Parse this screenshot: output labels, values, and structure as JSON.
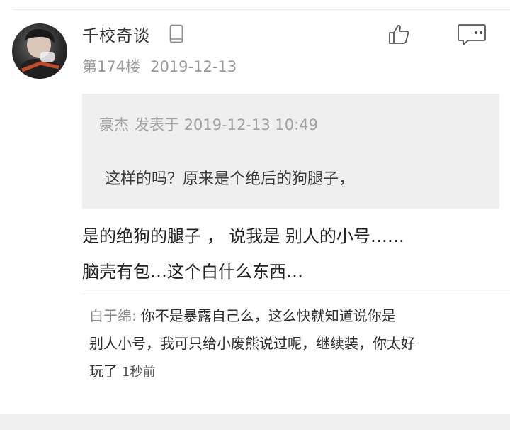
{
  "post": {
    "username": "千校奇谈",
    "floor": "第174楼",
    "date": "2019-12-13",
    "quote": {
      "author": "豪杰",
      "posted_label": "发表于",
      "datetime": "2019-12-13 10:49",
      "text": "这样的吗？原来是个绝后的狗腿子，"
    },
    "body_lines": [
      "是的绝狗的腿子 ， 说我是 别人的小号……",
      "脑壳有包…这个白什么东西…"
    ],
    "sub_reply": {
      "author": "白于绵:",
      "line1": "你不是暴露自己么，这么快就知道说你是",
      "line2": "别人小号，我可只给小废熊说过呢，继续装，你太好",
      "line3": "玩了",
      "time": "1秒前"
    }
  },
  "icons": {
    "device": "phone-icon",
    "like": "thumbs-up-icon",
    "reply": "comment-bubble-icon"
  },
  "colors": {
    "username": "#333333",
    "meta": "#9a9a9a",
    "quote_bg": "#efefef",
    "body_text": "#1f1f1f"
  }
}
